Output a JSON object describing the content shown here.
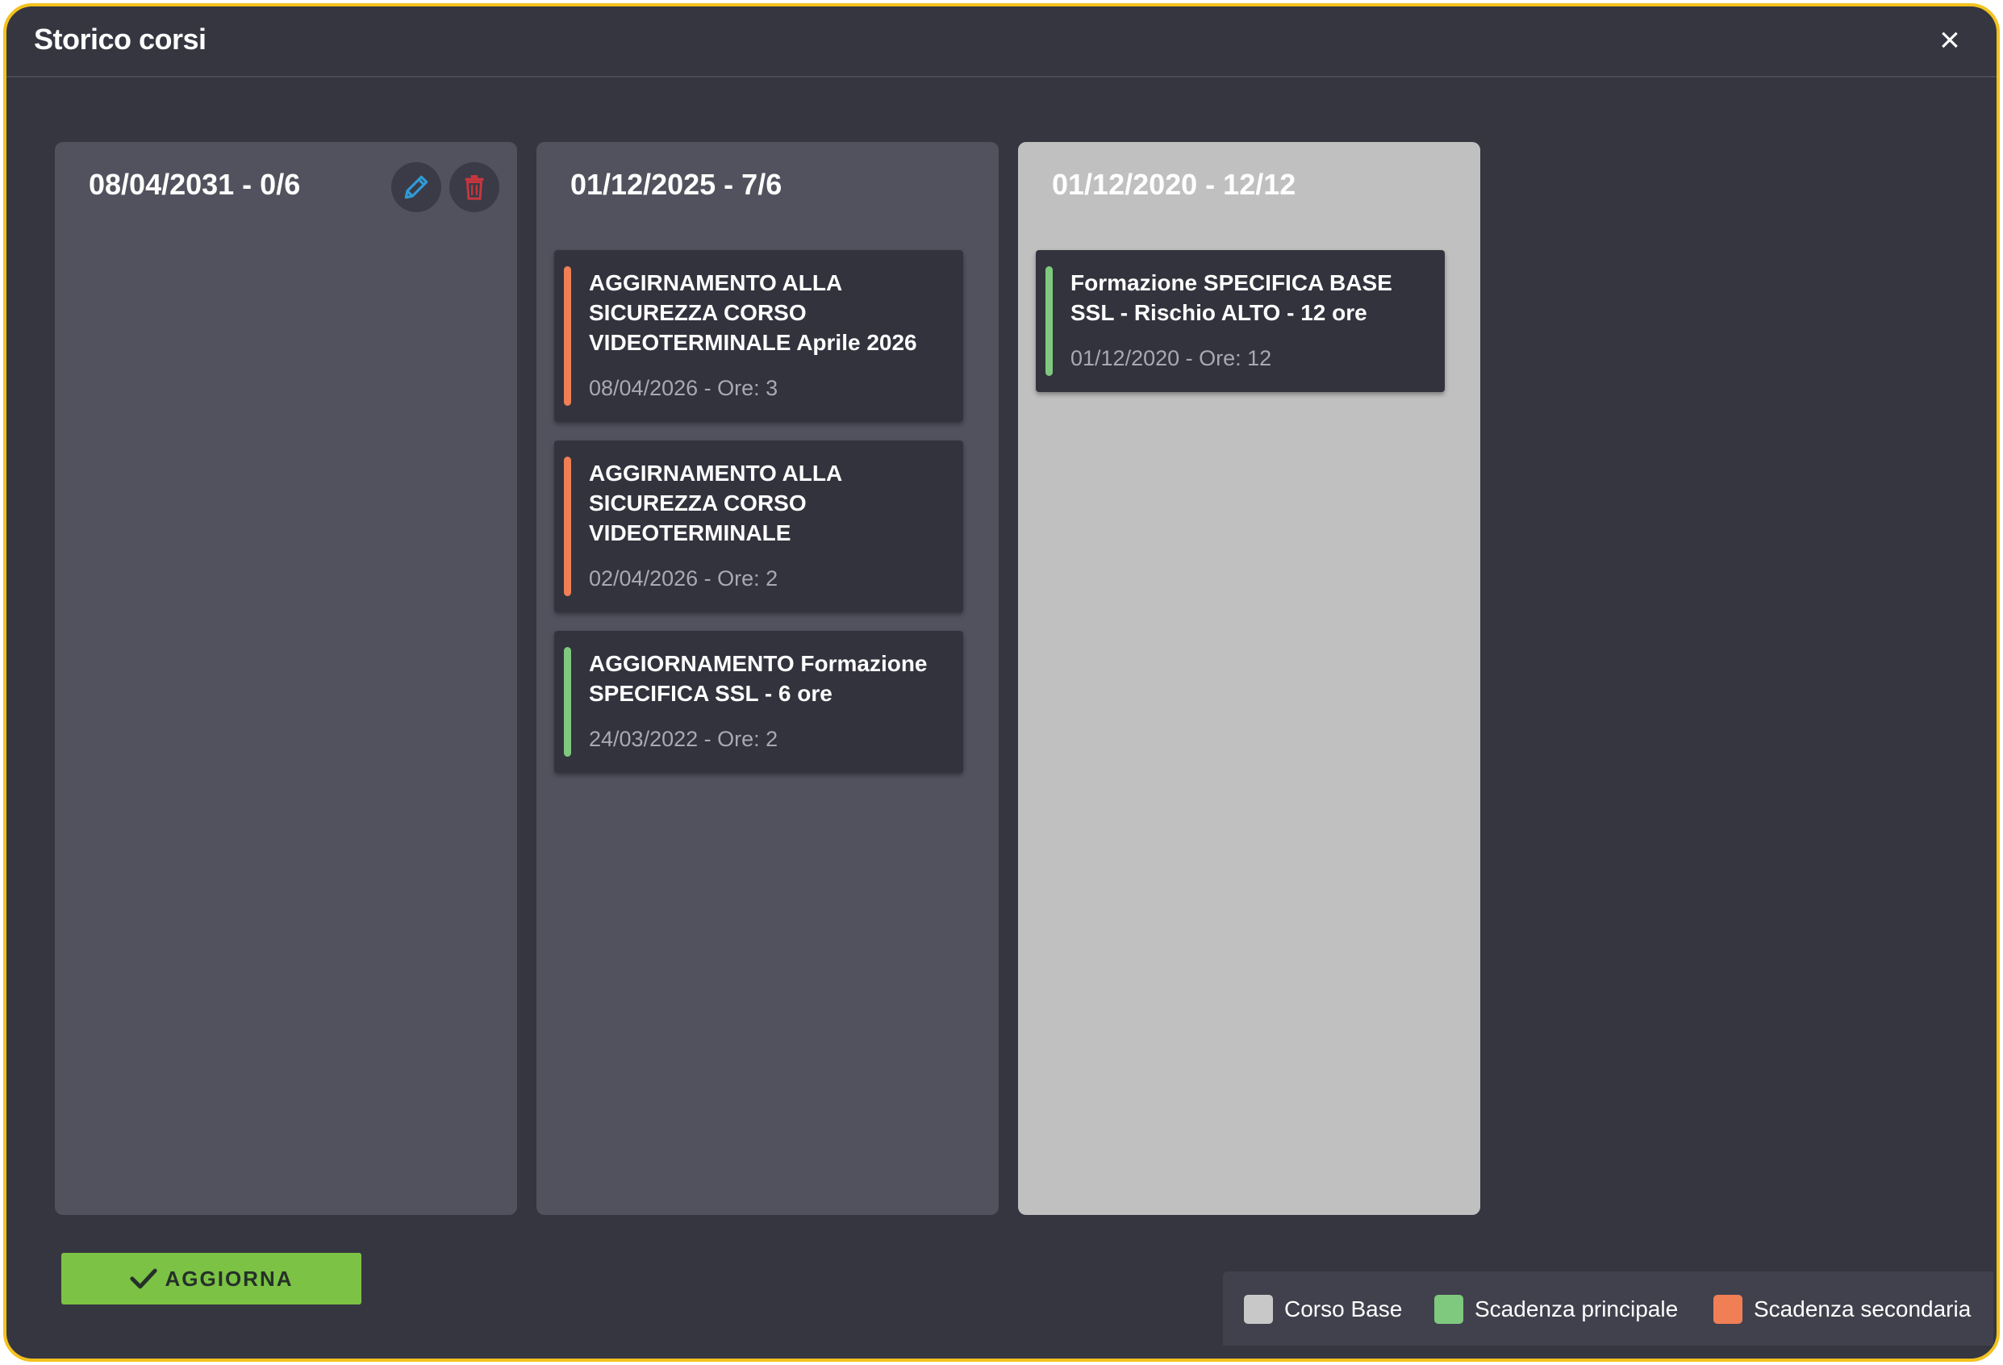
{
  "dialog": {
    "title": "Storico corsi",
    "close_label": "×"
  },
  "columns": [
    {
      "header": "08/04/2031 - 0/6",
      "actions": [
        "pencil-icon",
        "trash-icon"
      ],
      "cards": []
    },
    {
      "header": "01/12/2025 - 7/6",
      "cards": [
        {
          "title": "AGGIRNAMENTO ALLA SICUREZZA CORSO VIDEOTERMINALE Aprile 2026",
          "meta": "08/04/2026 - Ore: 3",
          "type": "secondary"
        },
        {
          "title": "AGGIRNAMENTO ALLA SICUREZZA CORSO VIDEOTERMINALE",
          "meta": "02/04/2026 - Ore: 2",
          "type": "secondary"
        },
        {
          "title": "AGGIORNAMENTO Formazione SPECIFICA SSL - 6 ore",
          "meta": "24/03/2022 - Ore: 2",
          "type": "primary"
        }
      ]
    },
    {
      "header": "01/12/2020 - 12/12",
      "type": "base",
      "cards": [
        {
          "title": "Formazione SPECIFICA BASE SSL - Rischio ALTO - 12 ore",
          "meta": "01/12/2020 - Ore: 12",
          "type": "primary"
        }
      ]
    }
  ],
  "footer": {
    "update_label": "AGGIORNA",
    "update_icon": "checkmark-icon"
  },
  "legend": [
    {
      "label": "Corso Base",
      "color": "#c8c8c8"
    },
    {
      "label": "Scadenza principale",
      "color": "#7fc97f"
    },
    {
      "label": "Scadenza secondaria",
      "color": "#f07f56"
    }
  ],
  "colors": {
    "accent_border": "#f3c21e",
    "primary": "#7fc97f",
    "secondary": "#f07f56",
    "edit_icon": "#2f9bd6",
    "delete_icon": "#c9363e",
    "update_button": "#7cc244"
  }
}
